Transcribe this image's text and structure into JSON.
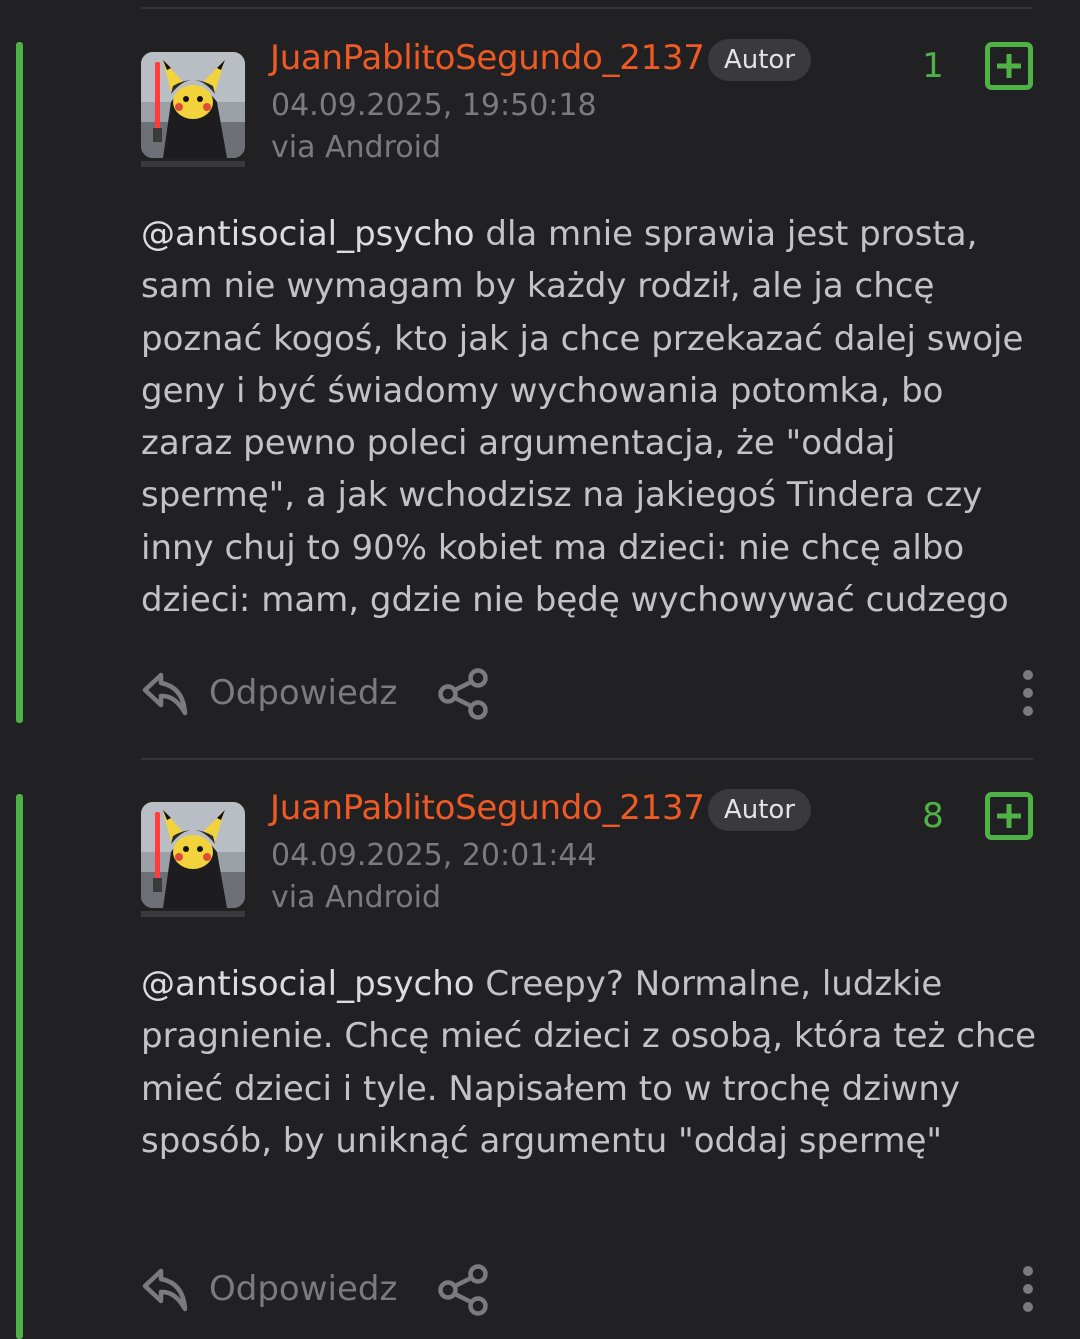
{
  "comments": [
    {
      "username": "JuanPablitoSegundo_2137",
      "badge": "Autor",
      "date": "04.09.2025, 19:50:18",
      "via": "via Android",
      "score": "1",
      "mention": "@antisocial_psycho",
      "text": " dla mnie sprawia jest prosta, sam nie wymagam by każdy rodził, ale ja chcę poznać kogoś, kto jak ja chce przekazać dalej swoje geny i być świadomy wychowania potomka, bo zaraz pewno poleci argumentacja, że \"oddaj spermę\", a jak wchodzisz na jakiegoś Tindera czy inny chuj to 90% kobiet ma dzieci: nie chcę albo dzieci: mam, gdzie nie będę wychowywać cudzego",
      "reply_label": "Odpowiedz"
    },
    {
      "username": "JuanPablitoSegundo_2137",
      "badge": "Autor",
      "date": "04.09.2025, 20:01:44",
      "via": "via Android",
      "score": "8",
      "mention": "@antisocial_psycho",
      "text": " Creepy? Normalne, ludzkie pragnienie. Chcę mieć dzieci z osobą, która też chce mieć dzieci i tyle. Napisałem to w trochę dziwny sposób, by uniknąć argumentu \"oddaj spermę\"",
      "reply_label": "Odpowiedz"
    }
  ],
  "colors": {
    "background": "#212123",
    "username": "#ef5a24",
    "accent_green": "#4fb246",
    "meta_text": "#7b7b7f",
    "body_text": "#c3c3c6"
  },
  "icons": {
    "avatar": "pikachu-sith-avatar",
    "plus": "plus-square-icon",
    "reply": "reply-arrow-icon",
    "share": "share-icon",
    "more": "more-vertical-icon"
  }
}
